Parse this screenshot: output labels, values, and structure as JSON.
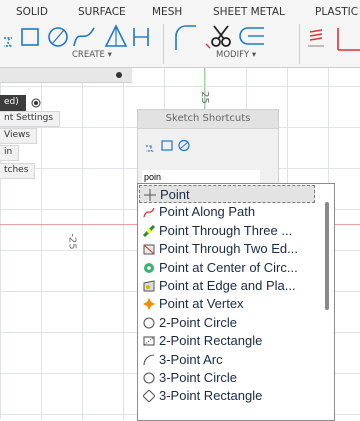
{
  "ribbon": {
    "tabs": [
      "SOLID",
      "SURFACE",
      "MESH",
      "SHEET METAL",
      "PLASTIC"
    ],
    "create_label": "CREATE ▾",
    "modify_label": "MODIFY ▾"
  },
  "canvas": {
    "dim_top": "25",
    "dim_left": "-25"
  },
  "browser": {
    "items": [
      "ed)",
      "nt Settings",
      "Views",
      "in",
      "tches"
    ]
  },
  "shortcuts": {
    "title": "Sketch Shortcuts",
    "search_value": "poin"
  },
  "results": {
    "items": [
      {
        "label": "Point",
        "icon": "point-icon"
      },
      {
        "label": "Point Along Path",
        "icon": "point-along-path-icon"
      },
      {
        "label": "Point Through Three ...",
        "icon": "point-through-three-icon"
      },
      {
        "label": "Point Through Two Ed...",
        "icon": "point-through-two-edges-icon"
      },
      {
        "label": "Point at Center of Circ...",
        "icon": "point-at-center-icon"
      },
      {
        "label": "Point at Edge and Pla...",
        "icon": "point-at-edge-plane-icon"
      },
      {
        "label": "Point at Vertex",
        "icon": "point-at-vertex-icon"
      },
      {
        "label": "2-Point Circle",
        "icon": "circle-icon"
      },
      {
        "label": "2-Point Rectangle",
        "icon": "rectangle-icon"
      },
      {
        "label": "3-Point Arc",
        "icon": "arc-icon"
      },
      {
        "label": "3-Point Circle",
        "icon": "circle-icon"
      },
      {
        "label": "3-Point Rectangle",
        "icon": "rectangle-3pt-icon"
      }
    ]
  },
  "colors": {
    "accent": "#2a7cd3",
    "axis_red": "#e7a2a2",
    "axis_green": "#9ed39e"
  }
}
